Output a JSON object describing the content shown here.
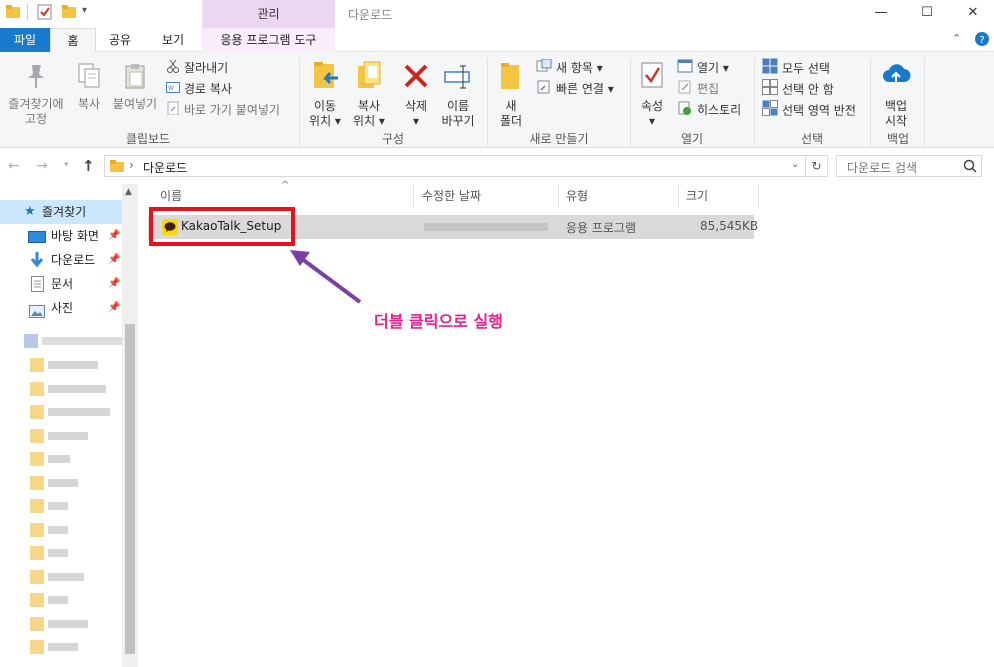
{
  "window": {
    "title": "다운로드",
    "context_tab": "관리",
    "minimize": "—",
    "maximize": "☐",
    "close": "✕"
  },
  "tabs": {
    "file": "파일",
    "home": "홈",
    "share": "공유",
    "view": "보기",
    "app_tools": "응용 프로그램 도구"
  },
  "ribbon": {
    "clipboard": {
      "pin_line1": "즐겨찾기에",
      "pin_line2": "고정",
      "copy": "복사",
      "paste": "붙여넣기",
      "cut": "잘라내기",
      "copy_path": "경로 복사",
      "paste_shortcut": "바로 가기 붙여넣기",
      "label": "클립보드"
    },
    "organize": {
      "move_line1": "이동",
      "move_line2": "위치 ▾",
      "copyto_line1": "복사",
      "copyto_line2": "위치 ▾",
      "delete_line1": "삭제",
      "delete_line2": "▾",
      "rename_line1": "이름",
      "rename_line2": "바꾸기",
      "label": "구성"
    },
    "new": {
      "folder_line1": "새",
      "folder_line2": "폴더",
      "new_item": "새 항목 ▾",
      "easy_access": "빠른 연결 ▾",
      "label": "새로 만들기"
    },
    "open": {
      "props_line1": "속성",
      "props_line2": "▾",
      "open": "열기 ▾",
      "edit": "편집",
      "history": "히스토리",
      "label": "열기"
    },
    "select": {
      "select_all": "모두 선택",
      "select_none": "선택 안 함",
      "invert": "선택 영역 반전",
      "label": "선택"
    },
    "backup": {
      "line1": "백업",
      "line2": "시작",
      "label": "백업"
    }
  },
  "address": {
    "path": "다운로드",
    "search_placeholder": "다운로드 검색"
  },
  "nav": {
    "quick_access": "즐겨찾기",
    "items": [
      "바탕 화면",
      "다운로드",
      "문서",
      "사진"
    ]
  },
  "columns": {
    "name": "이름",
    "date": "수정한 날짜",
    "type": "유형",
    "size": "크기"
  },
  "file": {
    "name": "KakaoTalk_Setup",
    "type": "응용 프로그램",
    "size": "85,545KB"
  },
  "annotation": "더블 클릭으로 실행",
  "colors": {
    "accent": "#1979ca",
    "highlight": "#e8111b",
    "arrow": "#7b3fa8",
    "annotation": "#e8208c"
  }
}
